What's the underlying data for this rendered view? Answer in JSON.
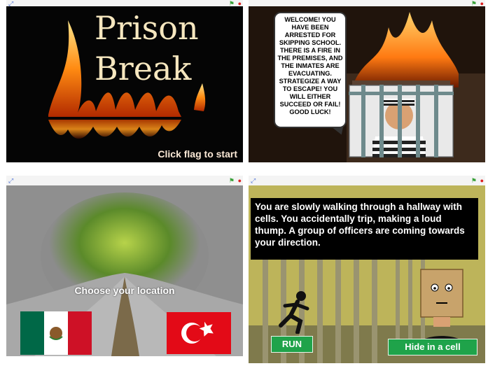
{
  "colors": {
    "run_button": "#1fa34a",
    "hide_button": "#1fa34a",
    "story_box": "#000000",
    "mexico_green": "#006847",
    "mexico_red": "#ce1126",
    "turkey_red": "#e30a17"
  },
  "icons": {
    "fullscreen": "fullscreen-icon",
    "green_flag": "green-flag-icon",
    "stop": "stop-sign-icon"
  },
  "title_screen": {
    "title_line1": "Prison",
    "title_line2": "Break",
    "start_hint": "Click flag to start"
  },
  "intro_screen": {
    "message": "WELCOME! YOU HAVE BEEN ARRESTED FOR SKIPPING SCHOOL. THERE IS A FIRE IN THE PREMISES, AND THE INMATES ARE EVACUATING. STRATEGIZE A WAY TO ESCAPE! YOU WILL EITHER SUCCEED OR FAIL! GOOD LUCK!"
  },
  "location_screen": {
    "prompt": "Choose your location",
    "options": [
      "Mexico",
      "Turkey"
    ]
  },
  "hallway_screen": {
    "story": "You are slowly walking through a hallway with cells. You accidentally trip, making a loud thump. A group of officers are coming towards your direction.",
    "run_label": "RUN",
    "hide_label": "Hide in a cell"
  }
}
